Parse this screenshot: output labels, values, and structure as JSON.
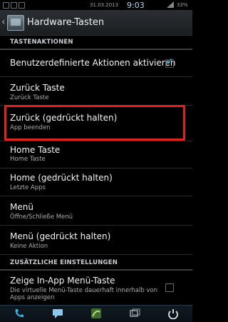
{
  "status_bar": {
    "date": "31.03.2013",
    "time": "9:03",
    "battery": "33%"
  },
  "action_bar": {
    "title": "Hardware-Tasten"
  },
  "sections": {
    "tastenaktionen": "TASTENAKTIONEN",
    "zusaetzliche": "ZUSÄTZLICHE EINSTELLUNGEN"
  },
  "items": [
    {
      "title": "Benutzerdefinierte Aktionen aktivieren",
      "subtitle": ""
    },
    {
      "title": "Zurück Taste",
      "subtitle": "Zurück Taste"
    },
    {
      "title": "Zurück (gedrückt halten)",
      "subtitle": "App beenden"
    },
    {
      "title": "Home Taste",
      "subtitle": "Home Taste"
    },
    {
      "title": "Home (gedrückt halten)",
      "subtitle": "Letzte Apps"
    },
    {
      "title": "Menü",
      "subtitle": "Öffne/Schließe Menü"
    },
    {
      "title": "Menü (gedrückt halten)",
      "subtitle": "Keine Aktion"
    },
    {
      "title": "Zeige In-App Menü-Taste",
      "subtitle_line1": "Die virtuelle Menü-Taste dauerhaft innerhalb von",
      "subtitle_line2": "Apps anzeigen"
    }
  ],
  "checkboxes": {
    "custom_actions_enabled": true,
    "show_inapp_menu": false
  },
  "icons": {
    "back": "chevron-left-icon",
    "app": "hardware-keys-app-icon",
    "nav": [
      "phone-icon",
      "chat-icon",
      "app-icon",
      "recent-apps-icon",
      "power-icon"
    ]
  },
  "colors": {
    "accent": "#33b5e5",
    "highlight": "#e0231c"
  }
}
